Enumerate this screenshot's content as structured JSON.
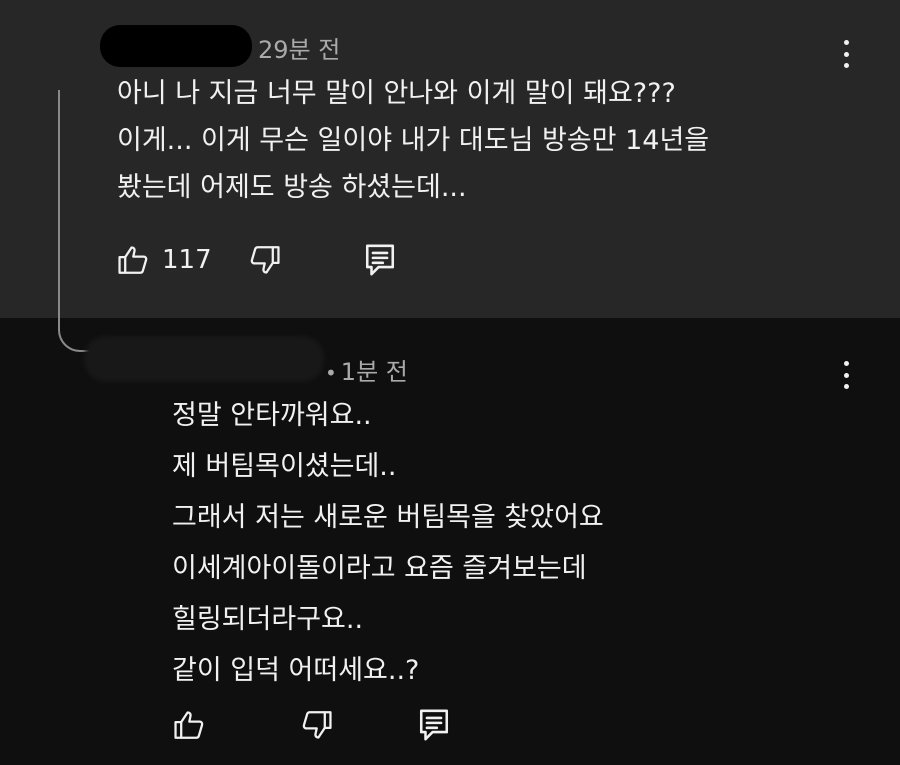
{
  "parent_comment": {
    "time": "29분 전",
    "lines": [
      "아니 나 지금 너무 말이 안나와 이게 말이 돼요???",
      "이게... 이게 무슨 일이야 내가 대도님 방송만 14년을",
      "봤는데 어제도 방송 하셨는데..."
    ],
    "like_count": "117",
    "icons": [
      "like-icon",
      "dislike-icon",
      "reply-icon",
      "more-options-icon"
    ]
  },
  "reply_comment": {
    "time": "1분 전",
    "lines": [
      "정말 안타까워요..",
      "제 버팀목이셨는데..",
      "그래서 저는 새로운 버팀목을 찾았어요",
      "이세계아이돌이라고 요즘 즐겨보는데",
      "힐링되더라구요..",
      "같이 입덕 어떠세요..?"
    ],
    "icons": [
      "like-icon",
      "dislike-icon",
      "reply-icon",
      "more-options-icon"
    ]
  },
  "colors": {
    "parent_background": "#272727",
    "reply_background": "#0f0f0f",
    "text": "#f1f1f1",
    "meta_text": "#aaaaaa"
  }
}
